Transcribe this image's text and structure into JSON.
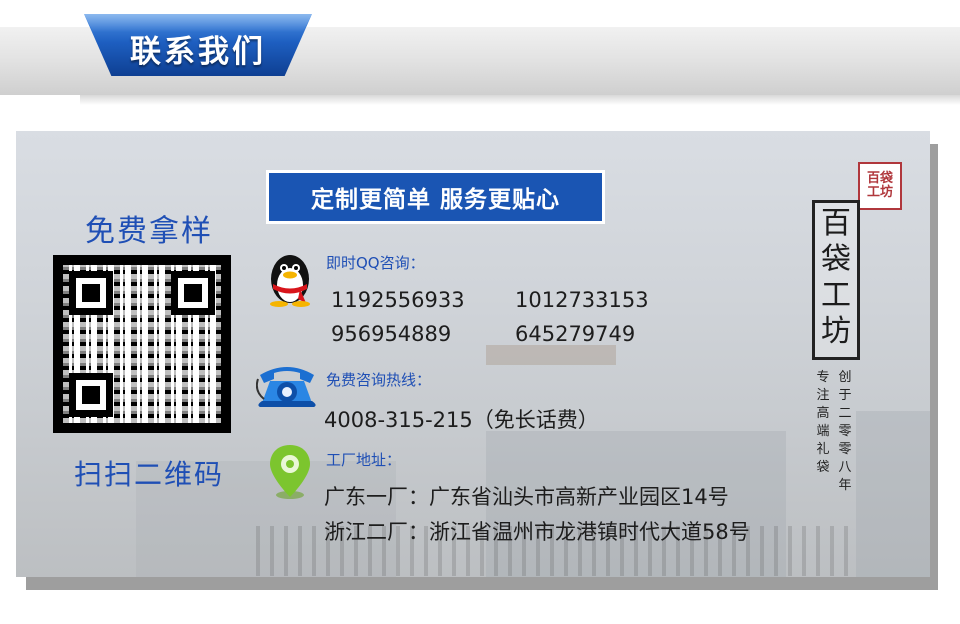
{
  "header": {
    "title": "联系我们"
  },
  "card": {
    "left": {
      "free_sample": "免费拿样",
      "scan_qr": "扫扫二维码"
    },
    "slogan": "定制更简单 服务更贴心",
    "qq": {
      "label": "即时QQ咨询：",
      "numbers": [
        "1192556933",
        "1012733153",
        "956954889",
        "645279749"
      ]
    },
    "hotline": {
      "label": "免费咨询热线：",
      "value": "4008-315-215（免长话费）"
    },
    "factory": {
      "label": "工厂地址：",
      "addresses": [
        "广东一厂：广东省汕头市高新产业园区14号",
        "浙江二厂：浙江省温州市龙港镇时代大道58号"
      ]
    },
    "brand": {
      "seal": "百袋工坊",
      "name": "百袋工坊",
      "tagline_left": "专注高端礼袋",
      "tagline_right": "创于二零零八年"
    },
    "colors": {
      "accent_blue": "#1a55b3",
      "seal_red": "#b0373c"
    },
    "icons": [
      "qq-penguin-icon",
      "telephone-icon",
      "location-pin-icon"
    ]
  }
}
